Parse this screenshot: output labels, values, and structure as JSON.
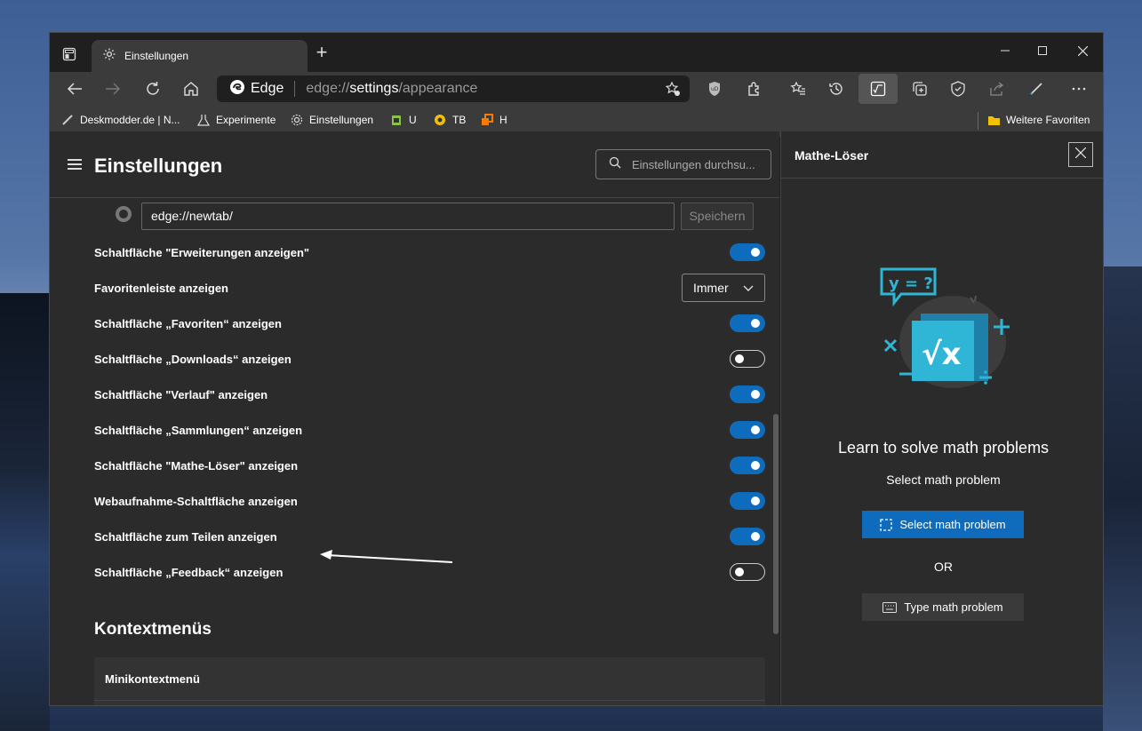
{
  "tab": {
    "title": "Einstellungen",
    "icons": [
      "tab-actions-icon",
      "gear-icon"
    ],
    "new_tab": "+"
  },
  "window_controls": {
    "minimize": "–",
    "maximize": "☐",
    "close": "✕"
  },
  "address_bar": {
    "brand": "Edge",
    "url_prefix": "edge://",
    "url_highlight": "settings",
    "url_suffix": "/appearance"
  },
  "favorites_bar": {
    "items": [
      {
        "label": "Deskmodder.de | N...",
        "icon": "pen-icon"
      },
      {
        "label": "Experimente",
        "icon": "flask-icon"
      },
      {
        "label": "Einstellungen",
        "icon": "gear-icon"
      },
      {
        "label": "U",
        "icon": "extension-icon"
      },
      {
        "label": "TB",
        "icon": "coin-icon"
      },
      {
        "label": "H",
        "icon": "share-icon"
      }
    ],
    "other": "Weitere Favoriten"
  },
  "settings": {
    "title": "Einstellungen",
    "search_placeholder": "Einstellungen durchsu...",
    "newtab_url": "edge://newtab/",
    "save_label": "Speichern",
    "rows": [
      {
        "label": "Schaltfläche \"Erweiterungen anzeigen\"",
        "control": "toggle",
        "on": true
      },
      {
        "label": "Favoritenleiste anzeigen",
        "control": "dropdown",
        "value": "Immer"
      },
      {
        "label": "Schaltfläche „Favoriten“ anzeigen",
        "control": "toggle",
        "on": true
      },
      {
        "label": "Schaltfläche „Downloads“ anzeigen",
        "control": "toggle",
        "on": false
      },
      {
        "label": "Schaltfläche \"Verlauf\" anzeigen",
        "control": "toggle",
        "on": true
      },
      {
        "label": "Schaltfläche „Sammlungen“ anzeigen",
        "control": "toggle",
        "on": true
      },
      {
        "label": "Schaltfläche \"Mathe-Löser\" anzeigen",
        "control": "toggle",
        "on": true
      },
      {
        "label": "Webaufnahme-Schaltfläche anzeigen",
        "control": "toggle",
        "on": true
      },
      {
        "label": "Schaltfläche zum Teilen anzeigen",
        "control": "toggle",
        "on": true
      },
      {
        "label": "Schaltfläche „Feedback“ anzeigen",
        "control": "toggle",
        "on": false
      }
    ],
    "section_heading": "Kontextmenüs",
    "card_label": "Minikontextmenü"
  },
  "side_panel": {
    "title": "Mathe-Löser",
    "illustration_text": "y = ?",
    "illustration_symbol": "√x",
    "heading": "Learn to solve math problems",
    "subheading": "Select math problem",
    "primary_button": "Select math problem",
    "or_text": "OR",
    "secondary_button": "Type math problem"
  },
  "colors": {
    "accent": "#0f6cbd",
    "window_bg": "#202020",
    "panel_bg": "#2b2b2b",
    "illustration_cyan": "#2fb6d6"
  }
}
